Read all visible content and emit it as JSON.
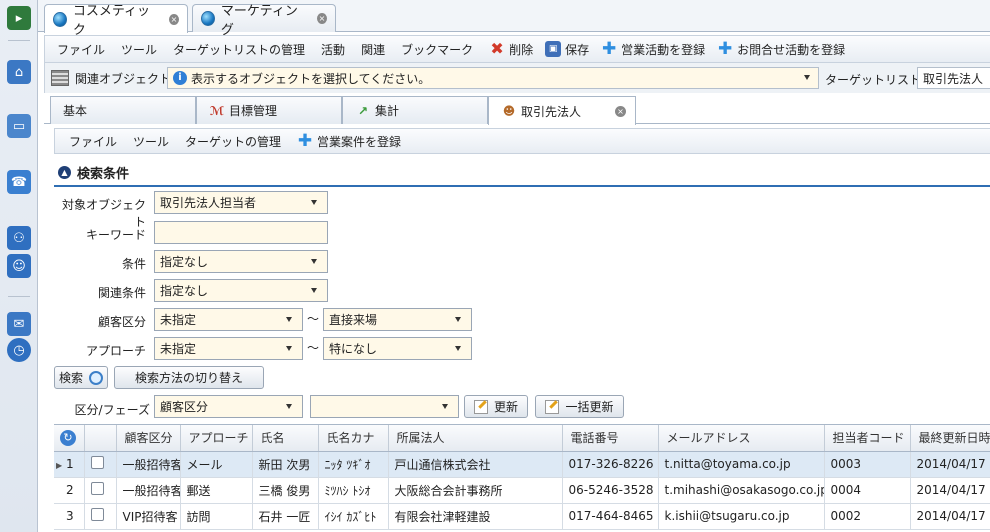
{
  "doc_tabs": [
    {
      "label": "コスメティック"
    },
    {
      "label": "マーケティング"
    }
  ],
  "menubar": {
    "items": [
      "ファイル",
      "ツール",
      "ターゲットリストの管理",
      "活動",
      "関連",
      "ブックマーク"
    ],
    "delete_label": "削除",
    "save_label": "保存",
    "register_sales_label": "営業活動を登録",
    "register_inquiry_label": "お問合せ活動を登録"
  },
  "related": {
    "label": "関連オブジェクト",
    "select_placeholder": "表示するオブジェクトを選択してください。",
    "target_list_label": "ターゲットリスト",
    "target_list_value": "取引先法人"
  },
  "inner_tabs": [
    {
      "label": "基本"
    },
    {
      "label": "目標管理"
    },
    {
      "label": "集計"
    },
    {
      "label": "取引先法人"
    }
  ],
  "subbar": {
    "items": [
      "ファイル",
      "ツール",
      "ターゲットの管理"
    ],
    "register_case_label": "営業案件を登録"
  },
  "search": {
    "title": "検索条件",
    "target_object_label": "対象オブジェクト",
    "target_object_value": "取引先法人担当者",
    "keyword_label": "キーワード",
    "keyword_value": "",
    "condition_label": "条件",
    "condition_value": "指定なし",
    "related_condition_label": "関連条件",
    "related_condition_value": "指定なし",
    "customer_type_label": "顧客区分",
    "customer_type_from": "未指定",
    "customer_type_to": "直接来場",
    "approach_label": "アプローチ",
    "approach_from": "未指定",
    "approach_to": "特になし",
    "tilde": "～",
    "search_button": "検索",
    "switch_button": "検索方法の切り替え",
    "phase_label": "区分/フェーズ",
    "phase_value": "顧客区分",
    "phase_value2": "",
    "update_button": "更新",
    "bulk_update_button": "一括更新"
  },
  "table": {
    "columns": [
      "顧客区分",
      "アプローチ",
      "氏名",
      "氏名カナ",
      "所属法人",
      "電話番号",
      "メールアドレス",
      "担当者コード",
      "最終更新日時"
    ],
    "rows": [
      {
        "num": "1",
        "customer_type": "一般招待客",
        "approach": "メール",
        "name": "新田 次男",
        "kana": "ﾆｯﾀ ﾂｷﾞｵ",
        "company": "戸山通信株式会社",
        "phone": "017-326-8226",
        "email": "t.nitta@toyama.co.jp",
        "code": "0003",
        "updated": "2014/04/17"
      },
      {
        "num": "2",
        "customer_type": "一般招待客",
        "approach": "郵送",
        "name": "三橋 俊男",
        "kana": "ﾐﾂﾊｼ ﾄｼｵ",
        "company": "大阪総合会計事務所",
        "phone": "06-5246-3528",
        "email": "t.mihashi@osakasogo.co.jp",
        "code": "0004",
        "updated": "2014/04/17"
      },
      {
        "num": "3",
        "customer_type": "VIP招待客",
        "approach": "訪問",
        "name": "石井 一匠",
        "kana": "ｲｼｲ ｶｽﾞﾋﾄ",
        "company": "有限会社津軽建設",
        "phone": "017-464-8465",
        "email": "k.ishii@tsugaru.co.jp",
        "code": "0002",
        "updated": "2014/04/17"
      }
    ]
  },
  "colors": {
    "accent": "#2f6eb3",
    "field_bg": "#fff9e8",
    "selected_row": "#dde9f5"
  }
}
